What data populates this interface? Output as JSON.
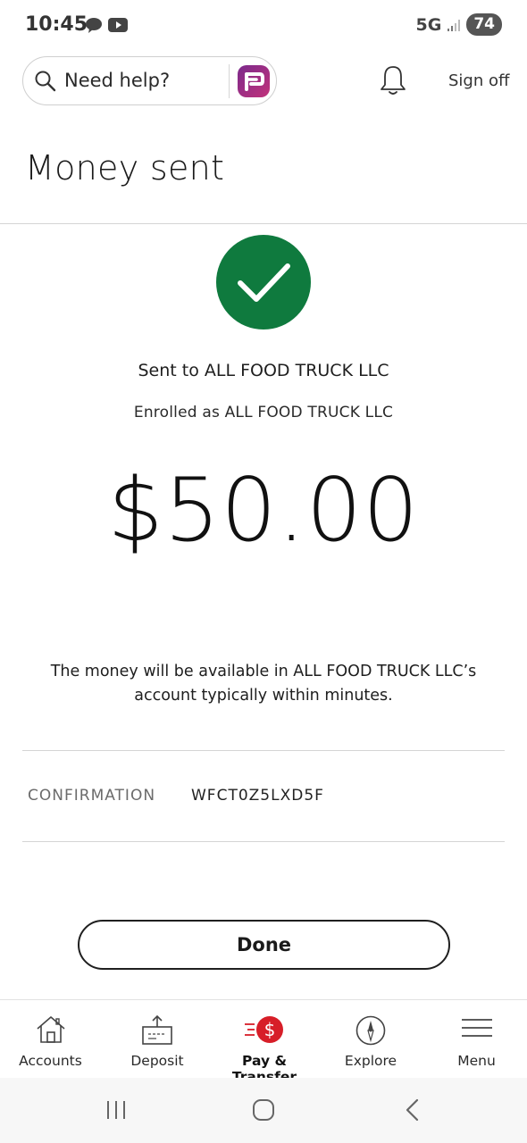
{
  "status_bar": {
    "time": "10:45",
    "network": "5G",
    "battery": "74"
  },
  "top_bar": {
    "search_label": "Need help?",
    "assistant_logo": "fargo-assistant-icon",
    "sign_off_label": "Sign off"
  },
  "page": {
    "title": "Money sent",
    "sent_to": "Sent to ALL FOOD TRUCK LLC",
    "enrolled_as": "Enrolled as ALL FOOD TRUCK LLC",
    "amount": "$50.00",
    "availability_line1": "The money will be available in ALL FOOD TRUCK LLC’s",
    "availability_line2": "account typically within minutes.",
    "confirmation_label": "CONFIRMATION",
    "confirmation_value": "WFCT0Z5LXD5F",
    "done_label": "Done"
  },
  "bottom_nav": {
    "items": [
      {
        "label": "Accounts",
        "icon": "home-icon",
        "active": false
      },
      {
        "label": "Deposit",
        "icon": "deposit-icon",
        "active": false
      },
      {
        "label": "Pay & Transfer",
        "icon": "pay-transfer-icon",
        "active": true
      },
      {
        "label": "Explore",
        "icon": "compass-icon",
        "active": false
      },
      {
        "label": "Menu",
        "icon": "menu-icon",
        "active": false
      }
    ]
  },
  "colors": {
    "success_green": "#0f7a3e",
    "accent_red": "#d71e28",
    "brand_purple": "#7b2a8c"
  }
}
